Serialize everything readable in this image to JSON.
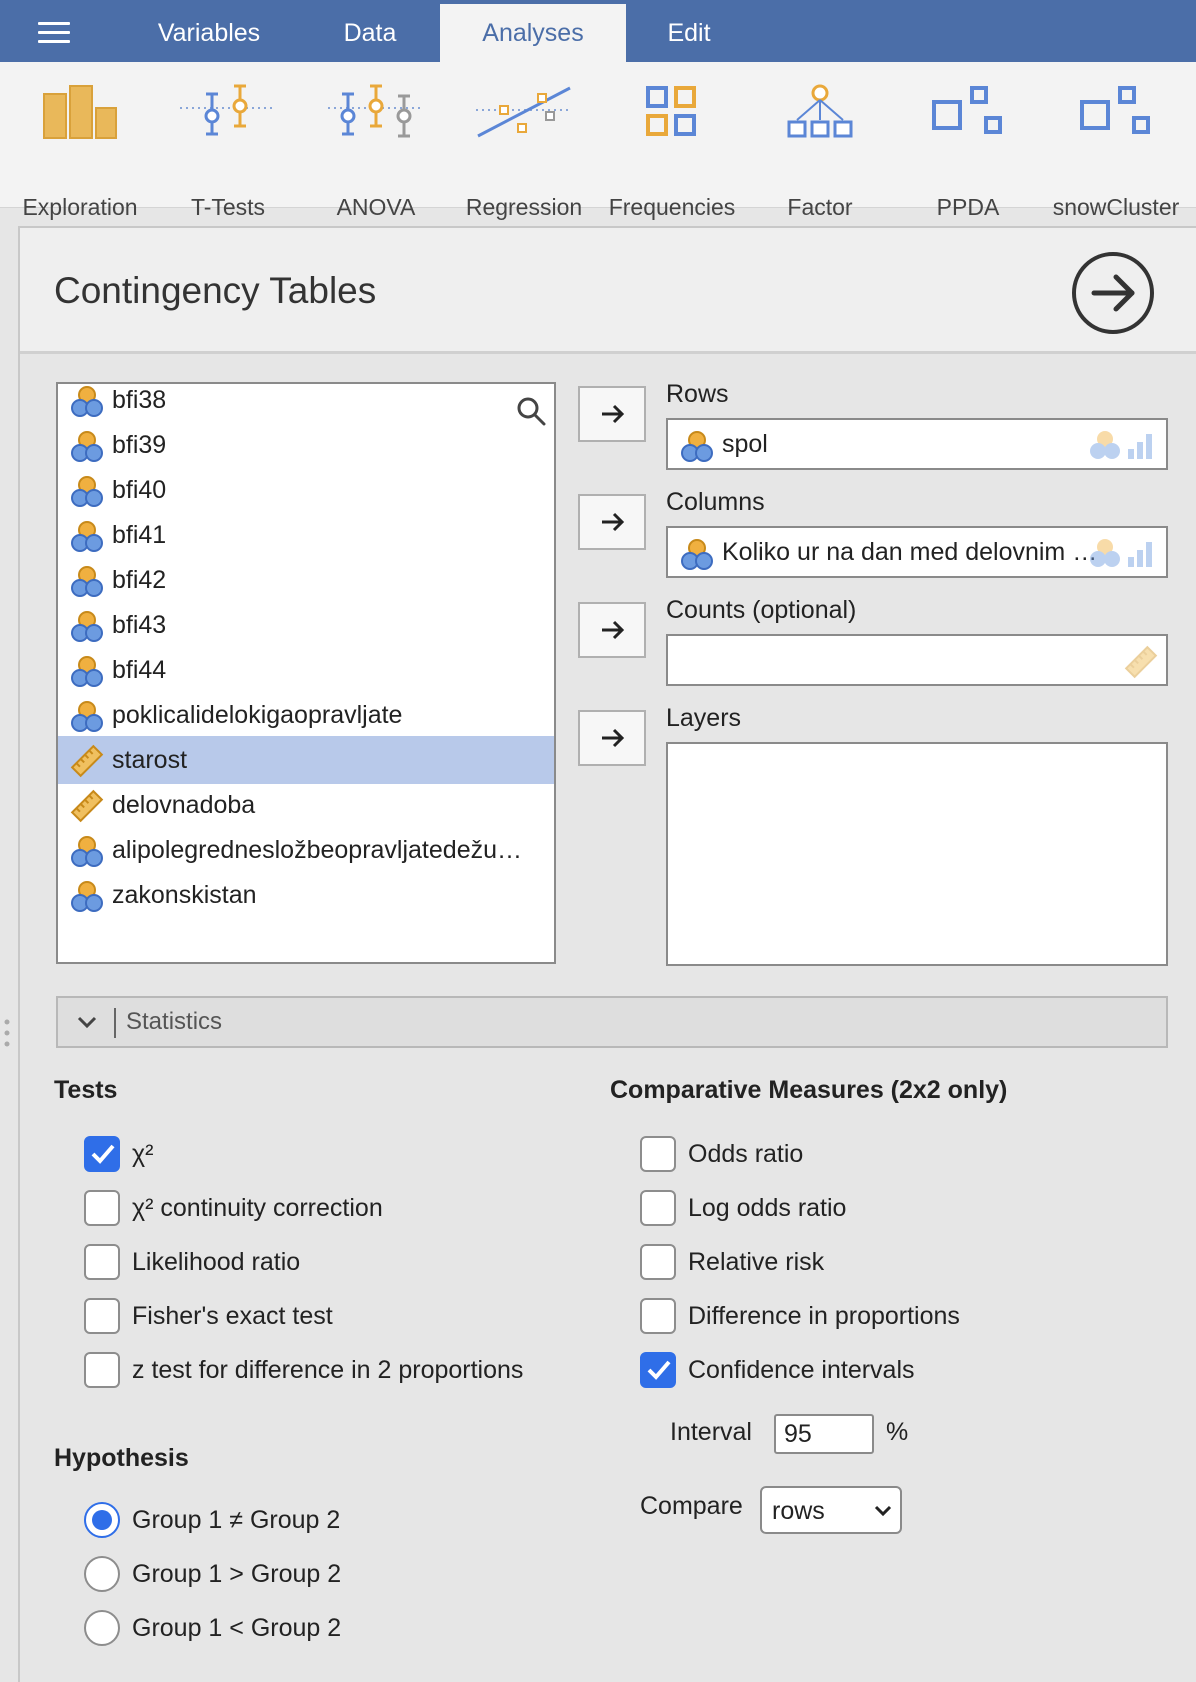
{
  "menubar": {
    "tabs": [
      {
        "label": "Variables"
      },
      {
        "label": "Data"
      },
      {
        "label": "Analyses",
        "active": true
      },
      {
        "label": "Edit"
      }
    ]
  },
  "ribbon": {
    "items": [
      {
        "label": "Exploration",
        "icon": "exploration-icon"
      },
      {
        "label": "T-Tests",
        "icon": "t-tests-icon"
      },
      {
        "label": "ANOVA",
        "icon": "anova-icon"
      },
      {
        "label": "Regression",
        "icon": "regression-icon"
      },
      {
        "label": "Frequencies",
        "icon": "frequencies-icon"
      },
      {
        "label": "Factor",
        "icon": "factor-icon"
      },
      {
        "label": "PPDA",
        "icon": "ppda-icon"
      },
      {
        "label": "snowCluster",
        "icon": "snowcluster-icon"
      }
    ]
  },
  "panel": {
    "title": "Contingency Tables",
    "run_icon": "arrow-right-circle-icon"
  },
  "variables": {
    "items": [
      {
        "name": "bfi38",
        "type": "nominal"
      },
      {
        "name": "bfi39",
        "type": "nominal"
      },
      {
        "name": "bfi40",
        "type": "nominal"
      },
      {
        "name": "bfi41",
        "type": "nominal"
      },
      {
        "name": "bfi42",
        "type": "nominal"
      },
      {
        "name": "bfi43",
        "type": "nominal"
      },
      {
        "name": "bfi44",
        "type": "nominal"
      },
      {
        "name": "poklicalidelokigaopravljate",
        "type": "nominal"
      },
      {
        "name": "starost",
        "type": "continuous",
        "selected": true
      },
      {
        "name": "delovnadoba",
        "type": "continuous"
      },
      {
        "name": "alipolegrednesluzbeopravljatedezu…",
        "display": "alipolegrednesložbeopravljatedežu…",
        "type": "nominal"
      },
      {
        "name": "zakonskistan",
        "type": "nominal"
      }
    ]
  },
  "targets": {
    "rows": {
      "label": "Rows",
      "value": "spol"
    },
    "columns": {
      "label": "Columns",
      "value": "Koliko ur na dan med delovnim ted…"
    },
    "counts": {
      "label": "Counts (optional)",
      "value": ""
    },
    "layers": {
      "label": "Layers"
    }
  },
  "statistics": {
    "header": "Statistics",
    "tests": {
      "title": "Tests",
      "options": [
        {
          "label": "χ²",
          "checked": true
        },
        {
          "label": "χ² continuity correction",
          "checked": false
        },
        {
          "label": "Likelihood ratio",
          "checked": false
        },
        {
          "label": "Fisher's exact test",
          "checked": false
        },
        {
          "label": "z test for difference in 2 proportions",
          "checked": false
        }
      ]
    },
    "hypothesis": {
      "title": "Hypothesis",
      "options": [
        {
          "label": "Group 1 ≠ Group 2",
          "checked": true
        },
        {
          "label": "Group 1 > Group 2",
          "checked": false
        },
        {
          "label": "Group 1 < Group 2",
          "checked": false
        }
      ]
    },
    "comparative": {
      "title": "Comparative Measures (2x2 only)",
      "options": [
        {
          "label": "Odds ratio",
          "checked": false
        },
        {
          "label": "Log odds ratio",
          "checked": false
        },
        {
          "label": "Relative risk",
          "checked": false
        },
        {
          "label": "Difference in proportions",
          "checked": false
        },
        {
          "label": "Confidence intervals",
          "checked": true
        }
      ],
      "interval_label": "Interval",
      "interval_value": "95",
      "interval_unit": "%",
      "compare_label": "Compare",
      "compare_value": "rows"
    }
  },
  "colors": {
    "menubar": "#4b6ea8",
    "accent": "#2f6ee8",
    "selected_row": "#b8c9ea",
    "nominal_icon_orange": "#f0b040",
    "nominal_icon_blue": "#6c9be0"
  }
}
